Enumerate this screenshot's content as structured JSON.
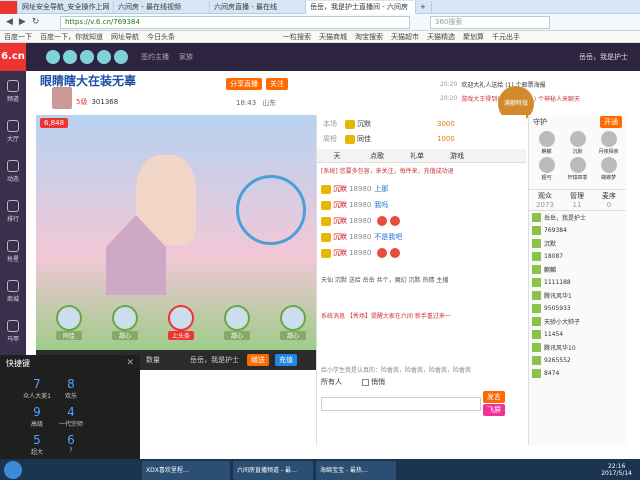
{
  "browser": {
    "tabs": [
      "网址安全导航_安全操作上网",
      "六间房 - 最在线视频",
      "六间房直播 - 最在线",
      "岳岳，我是护士直播间 - 六间房",
      "+"
    ],
    "url": "https://v.6.cn/769384",
    "search_placeholder": "360搜索",
    "bookmarks": [
      "百度一下",
      "百度一下，你就知道",
      "网址导航",
      "今日头条",
      "一粒搜索",
      "天猫商城",
      "淘宝搜索",
      "天猫超市",
      "天猫精选",
      "聚划算",
      "千元出手"
    ]
  },
  "site": {
    "logo": "6.cn",
    "nav": [
      "频道",
      "大厅",
      "动态",
      "排行",
      "抢星",
      "商城",
      "马甲"
    ],
    "header_links": [
      "签约主播",
      "家族"
    ],
    "user_label": "岳岳，我是护士"
  },
  "room": {
    "title": "眼睛瞎大在装无辜",
    "fans": "301368",
    "level_label": "5级",
    "location": "山东",
    "time": "18:43",
    "buttons": [
      "分享直播",
      "关注"
    ],
    "popularity": "6,848",
    "seat_labels": [
      "同佳",
      "甜心",
      "上头条",
      "甜心",
      "甜心"
    ]
  },
  "announce": {
    "lines": [
      {
        "time": "20:20",
        "text": "欢迎大礼人送给 (1) 个邮票海报"
      },
      {
        "time": "20:20",
        "text": "游戏大王得到(1) 发射了 (1) 个神秘人来聊天"
      }
    ],
    "special_label": "满额特效"
  },
  "chat": {
    "rank_rows": [
      {
        "label": "本场",
        "name": "沉默",
        "amount": "3000"
      },
      {
        "label": "周榜",
        "name": "同佳",
        "amount": "1000"
      }
    ],
    "tabs": [
      "天",
      "点歌",
      "礼单",
      "游戏"
    ],
    "notice": "[系统] 您要多包容，来关注，每件来，充值成功退",
    "messages": [
      {
        "name": "沉默",
        "id": "18980",
        "text": "上那"
      },
      {
        "name": "沉默",
        "id": "18980",
        "text": "我吗"
      },
      {
        "name": "沉默",
        "id": "18980",
        "text": ""
      },
      {
        "name": "沉默",
        "id": "18980",
        "text": "不是我吧"
      },
      {
        "name": "沉默",
        "id": "18980",
        "text": ""
      }
    ],
    "system_tip": "系统消息 【秀场】提醒大家在六间 新手重过来一",
    "gift_line": "天仙 沉默 送给 岳岳 共个，魔幻 沉默 热情 主播",
    "input_tip": "给小学生我是认真的：险香我，险香我，险香我，险香我",
    "to_label": "所有人",
    "private_label": "悄悄",
    "send_label": "发言",
    "flying_label": "飞屏"
  },
  "guard": {
    "title": "守护",
    "open_label": "开通",
    "names": [
      "麒麟",
      "沉默",
      "月夜相亲",
      "超可",
      "轩辕四季",
      "蝴蝶梦"
    ]
  },
  "audience": {
    "tabs": [
      {
        "label": "观众",
        "count": "2073"
      },
      {
        "label": "管理",
        "count": "11"
      },
      {
        "label": "麦序",
        "count": "0"
      }
    ],
    "items": [
      "岳岳，我是护士",
      "769384",
      "沉默",
      "18087",
      "麒麟",
      "1111188",
      "腾讯风华1",
      "9505933",
      "天骄小大帅子",
      "11454",
      "腾讯风华10",
      "9265552",
      "8474"
    ]
  },
  "shortcut": {
    "title": "快捷键",
    "cells": [
      {
        "key": "7",
        "label": "众人大美1"
      },
      {
        "key": "8",
        "label": "欢乐"
      },
      {
        "key": "9",
        "label": "高级"
      },
      {
        "key": "4",
        "label": "一代宗师"
      },
      {
        "key": "5",
        "label": "超大"
      },
      {
        "key": "6",
        "label": "?"
      }
    ]
  },
  "video_controls": {
    "gift_placeholder": "数量",
    "target": "岳岳，我是护士",
    "give_label": "赠送",
    "recharge_label": "充值"
  },
  "taskbar": {
    "items": [
      "XDX喜欢里程…",
      "六间房直播频道 - 最…",
      "海绵宝宝 - 最热…"
    ],
    "time": "22:16",
    "date": "2017/5/14"
  },
  "colors": {
    "accent": "#ff6a00",
    "sitebar": "#2d2540",
    "taskbar": "#1b3550"
  }
}
